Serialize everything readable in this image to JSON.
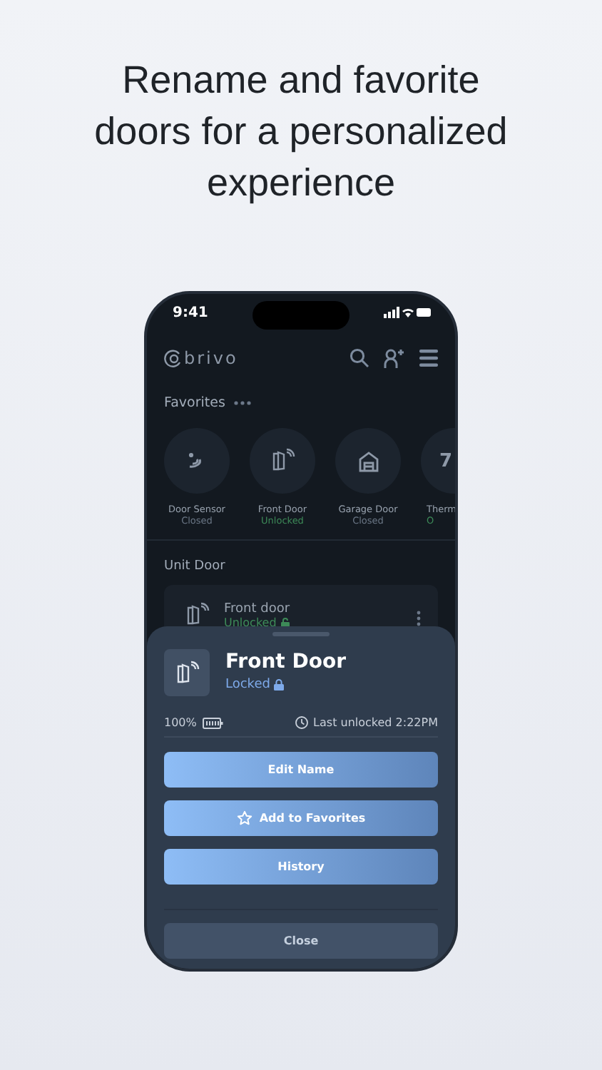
{
  "headline": "Rename and favorite doors for a personalized experience",
  "status_bar": {
    "time": "9:41"
  },
  "app": {
    "logo": "brivo"
  },
  "favorites": {
    "title": "Favorites",
    "items": [
      {
        "kind": "sensor",
        "name": "Door Sensor",
        "status": "Closed",
        "color": "#6b7786"
      },
      {
        "kind": "door",
        "name": "Front Door",
        "status": "Unlocked",
        "color": "#3d8a58"
      },
      {
        "kind": "garage",
        "name": "Garage Door",
        "status": "Closed",
        "color": "#6b7786"
      },
      {
        "kind": "reading",
        "reading": "7",
        "name": "Therm",
        "status": "O",
        "color": "#3d8a58"
      }
    ]
  },
  "unit_door": {
    "title": "Unit Door",
    "device": {
      "name": "Front door",
      "status": "Unlocked",
      "color": "#3d8a58"
    }
  },
  "sheet": {
    "title": "Front Door",
    "status": "Locked",
    "battery": "100%",
    "last_unlocked": "Last unlocked 2:22PM",
    "buttons": [
      {
        "label": "Edit Name",
        "kind": "plain"
      },
      {
        "label": "Add to Favorites",
        "kind": "favorite"
      },
      {
        "label": "History",
        "kind": "plain"
      }
    ],
    "close": "Close"
  }
}
